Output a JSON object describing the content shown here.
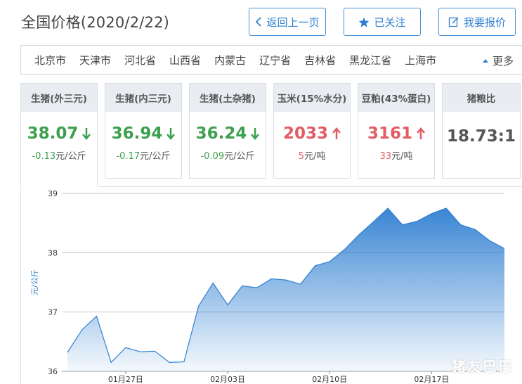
{
  "page": {
    "title": "全国价格(2020/2/22)"
  },
  "actions": {
    "back": "返回上一页",
    "follow": "已关注",
    "quote": "我要报价"
  },
  "regions": [
    "北京市",
    "天津市",
    "河北省",
    "山西省",
    "内蒙古",
    "辽宁省",
    "吉林省",
    "黑龙江省",
    "上海市"
  ],
  "more_label": "更多",
  "cards": [
    {
      "name": "生猪(外三元)",
      "value": "38.07",
      "trend": "down",
      "change": "-0.13",
      "unit": "元/公斤"
    },
    {
      "name": "生猪(内三元)",
      "value": "36.94",
      "trend": "down",
      "change": "-0.17",
      "unit": "元/公斤"
    },
    {
      "name": "生猪(土杂猪)",
      "value": "36.24",
      "trend": "down",
      "change": "-0.09",
      "unit": "元/公斤"
    },
    {
      "name": "玉米(15%水分)",
      "value": "2033",
      "trend": "up",
      "change": "5",
      "unit": "元/吨"
    },
    {
      "name": "豆粕(43%蛋白)",
      "value": "3161",
      "trend": "up",
      "change": "33",
      "unit": "元/吨"
    },
    {
      "name": "猪粮比",
      "value": "18.73:1",
      "trend": "none",
      "change": "",
      "unit": ""
    }
  ],
  "colors": {
    "accent": "#2f7fd1",
    "down": "#3da04f",
    "up": "#e25c63"
  },
  "watermark": "猪友巴巴",
  "chart_data": {
    "type": "area",
    "ylabel": "元/公斤",
    "ylim": [
      36,
      39
    ],
    "yticks": [
      36,
      37,
      38,
      39
    ],
    "xticks": [
      "01月27日",
      "02月03日",
      "02月10日",
      "02月17日"
    ],
    "x": [
      "01月23日",
      "01月24日",
      "01月25日",
      "01月26日",
      "01月27日",
      "01月28日",
      "01月29日",
      "01月30日",
      "01月31日",
      "02月01日",
      "02月02日",
      "02月03日",
      "02月04日",
      "02月05日",
      "02月06日",
      "02月07日",
      "02月08日",
      "02月09日",
      "02月10日",
      "02月11日",
      "02月12日",
      "02月13日",
      "02月14日",
      "02月15日",
      "02月16日",
      "02月17日",
      "02月18日",
      "02月19日",
      "02月20日",
      "02月21日",
      "02月22日"
    ],
    "series": [
      {
        "values": [
          36.32,
          36.7,
          36.93,
          36.15,
          36.4,
          36.33,
          36.34,
          36.15,
          36.16,
          37.1,
          37.49,
          37.12,
          37.44,
          37.41,
          37.56,
          37.54,
          37.47,
          37.78,
          37.85,
          38.05,
          38.3,
          38.52,
          38.75,
          38.47,
          38.53,
          38.66,
          38.75,
          38.47,
          38.39,
          38.2,
          38.07
        ]
      }
    ],
    "grid": true,
    "legend": "none"
  }
}
